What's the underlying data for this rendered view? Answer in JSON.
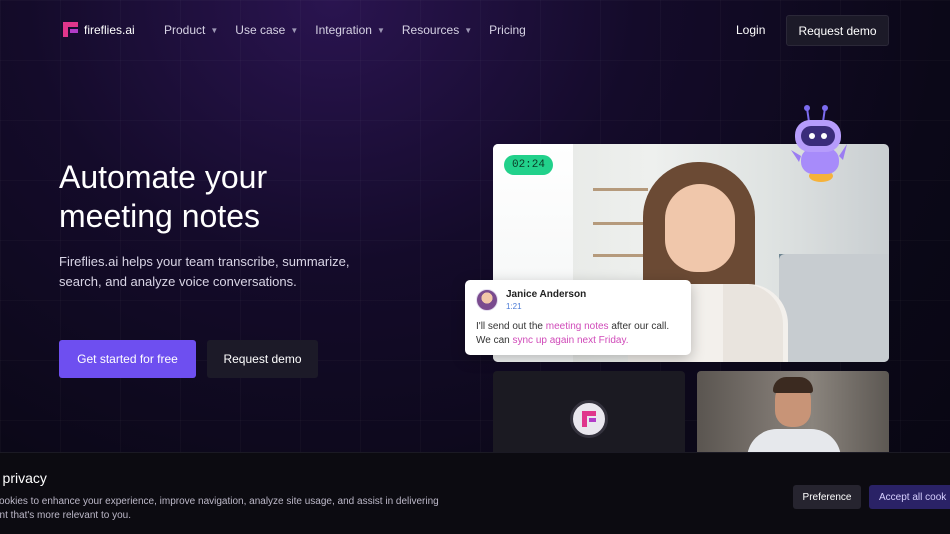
{
  "brand": {
    "name": "fireflies.ai",
    "logo_icon": "fireflies-logo-icon",
    "accent": "#6e4ff0",
    "logo_color": "#e0368c"
  },
  "nav": {
    "menu": [
      {
        "label": "Product",
        "has_dropdown": true
      },
      {
        "label": "Use case",
        "has_dropdown": true
      },
      {
        "label": "Integration",
        "has_dropdown": true
      },
      {
        "label": "Resources",
        "has_dropdown": true
      },
      {
        "label": "Pricing",
        "has_dropdown": false
      }
    ],
    "login": "Login",
    "request_demo": "Request demo"
  },
  "hero": {
    "title_line1": "Automate your",
    "title_line2": "meeting notes",
    "subtitle": "Fireflies.ai helps your team transcribe, summarize, search, and analyze voice conversations.",
    "cta_primary": "Get started for free",
    "cta_secondary": "Request demo"
  },
  "video": {
    "timer": "02:24",
    "timer_color": "#22d18b",
    "chat": {
      "name": "Janice Anderson",
      "time": "1:21",
      "text_pre": "I'll send out the ",
      "highlight1": "meeting notes",
      "text_mid": " after our call. We can ",
      "highlight2": "sync up again next Friday.",
      "highlight_color": "#d04ab9"
    }
  },
  "cookie": {
    "title": "r privacy",
    "text": "cookies to enhance your experience, improve navigation, analyze site usage, and assist in delivering ent that's more relevant to you.",
    "preference": "Preference",
    "accept": "Accept all cook"
  }
}
